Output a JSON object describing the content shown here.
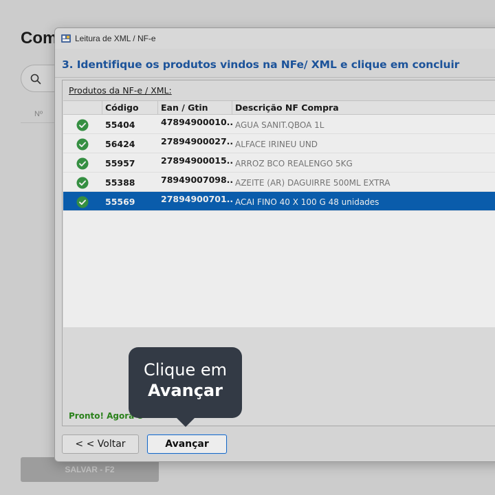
{
  "background": {
    "title": "Com",
    "column_header": "Nº",
    "save_button": "SALVAR - F2",
    "icons": {
      "search": "search-icon"
    }
  },
  "dialog": {
    "title": "Leitura de XML / NF-e",
    "step_heading": "3. Identifique os produtos vindos na NFe/ XML e clique em concluir",
    "products_label": "Produtos da NF-e / XML:",
    "columns": [
      "Código",
      "Ean / Gtin",
      "Descrição NF Compra"
    ],
    "rows": [
      {
        "code": "55404",
        "ean": "47894900010...",
        "description": "AGUA SANIT.QBOA 1L",
        "selected": false
      },
      {
        "code": "56424",
        "ean": "27894900027...",
        "description": "ALFACE IRINEU UND",
        "selected": false
      },
      {
        "code": "55957",
        "ean": "27894900015...",
        "description": "ARROZ BCO REALENGO 5KG",
        "selected": false
      },
      {
        "code": "55388",
        "ean": "78949007098...",
        "description": "AZEITE (AR) DAGUIRRE 500ML EXTRA",
        "selected": false
      },
      {
        "code": "55569",
        "ean": "27894900701...",
        "description": "ACAI FINO 40 X 100 G 48 unidades",
        "selected": true
      }
    ],
    "status_text": "Pronto! Agora é",
    "back_button": "< < Voltar",
    "next_button": "Avançar",
    "colors": {
      "heading": "#1f5aa6",
      "selected_row": "#0b64b8",
      "check": "#3a9a48",
      "status": "#2e8b1e"
    }
  },
  "tooltip": {
    "line1": "Clique em",
    "line2": "Avançar"
  }
}
